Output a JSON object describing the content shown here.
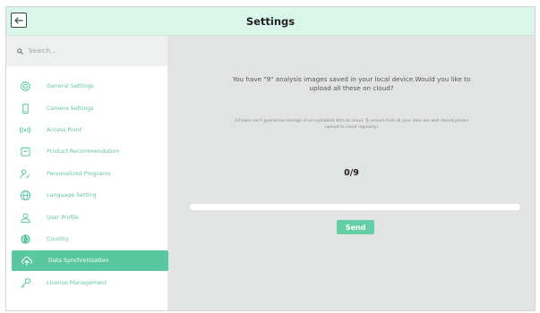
{
  "header": {
    "title": "Settings"
  },
  "search": {
    "placeholder": "Search..."
  },
  "sidebar": {
    "items": [
      {
        "label": "General Settings",
        "icon": "gear-icon"
      },
      {
        "label": "Camera Settings",
        "icon": "phone-icon"
      },
      {
        "label": "Access Point",
        "icon": "wifi-signal-icon"
      },
      {
        "label": "Product Recommendation",
        "icon": "shopping-bag-icon"
      },
      {
        "label": "Personalized Programs",
        "icon": "user-edit-icon"
      },
      {
        "label": "Language Setting",
        "icon": "globe-icon"
      },
      {
        "label": "User Profile",
        "icon": "user-icon"
      },
      {
        "label": "Country",
        "icon": "earth-icon"
      },
      {
        "label": "Data Synchronization",
        "icon": "cloud-upload-icon",
        "active": true
      },
      {
        "label": "License Management",
        "icon": "key-icon"
      }
    ]
  },
  "main": {
    "message_lines": [
      "You have \"9\" analysis images saved in your local device.Would you like to",
      "upload all these on cloud?"
    ],
    "note_lines": [
      "(Chowis can't guarantee storage of un-uploaded data to cloud. To ensure that all your data are well stored,please",
      "upload to cloud regularly)"
    ],
    "count": "0/9",
    "progress_fraction": 0,
    "send_label": "Send"
  },
  "colors": {
    "accent": "#59c79f",
    "header_bg": "#daf6ea",
    "main_bg": "#e2e4e3"
  }
}
